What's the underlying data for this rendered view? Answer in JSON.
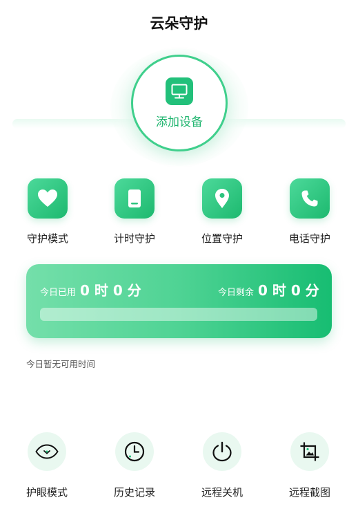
{
  "header": {
    "title": "云朵守护"
  },
  "add_device": {
    "label": "添加设备",
    "icon": "monitor-icon"
  },
  "features": [
    {
      "label": "守护模式",
      "icon": "heart-icon"
    },
    {
      "label": "计时守护",
      "icon": "phone-timer-icon"
    },
    {
      "label": "位置守护",
      "icon": "location-pin-icon"
    },
    {
      "label": "电话守护",
      "icon": "phone-call-icon"
    }
  ],
  "usage": {
    "used_label": "今日已用",
    "used_value": "0 时 0 分",
    "remaining_label": "今日剩余",
    "remaining_value": "0 时 0 分",
    "progress_fraction": 0
  },
  "status": {
    "no_time_text": "今日暂无可用时间"
  },
  "tools": [
    {
      "label": "护眼模式",
      "icon": "eye-icon"
    },
    {
      "label": "历史记录",
      "icon": "clock-icon"
    },
    {
      "label": "远程关机",
      "icon": "power-icon"
    },
    {
      "label": "远程截图",
      "icon": "crop-image-icon"
    }
  ],
  "colors": {
    "accent": "#22c07a",
    "accent_light": "#e9f8f0"
  }
}
